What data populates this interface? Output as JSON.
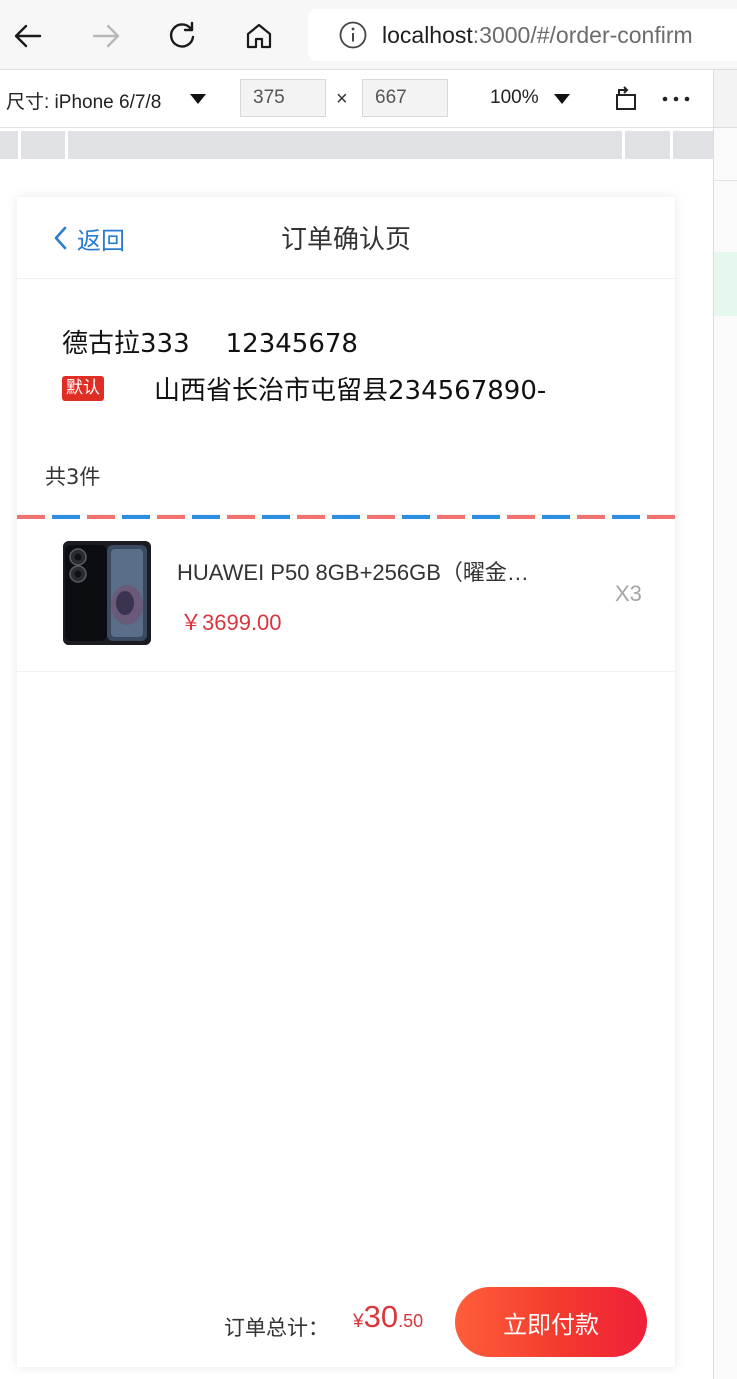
{
  "browser": {
    "url_host": "localhost",
    "url_rest": ":3000/#/order-confirm"
  },
  "device_toolbar": {
    "device_label": "尺寸: iPhone 6/7/8",
    "width_value": "375",
    "height_value": "667",
    "times_sign": "×",
    "zoom_label": "100%"
  },
  "app": {
    "back_label": "返回",
    "page_title": "订单确认页",
    "address": {
      "name": "德古拉333",
      "phone": "12345678",
      "default_tag": "默认",
      "detail": "山西省长治市屯留县234567890-"
    },
    "goods_count_text": "共3件",
    "goods": [
      {
        "name": "HUAWEI P50 8GB+256GB（曜金…",
        "price": "￥3699.00",
        "quantity": "X3"
      }
    ],
    "footer": {
      "total_label": "订单总计：",
      "currency": "¥",
      "total_int": "30",
      "total_dec": ".50",
      "pay_label": "立即付款"
    }
  },
  "colors": {
    "accent_blue": "#2b7cd3",
    "price_red": "#d9363e",
    "tag_red": "#e02e24",
    "pay_gradient_start": "#ff5e3a",
    "pay_gradient_end": "#ef1f3a"
  }
}
